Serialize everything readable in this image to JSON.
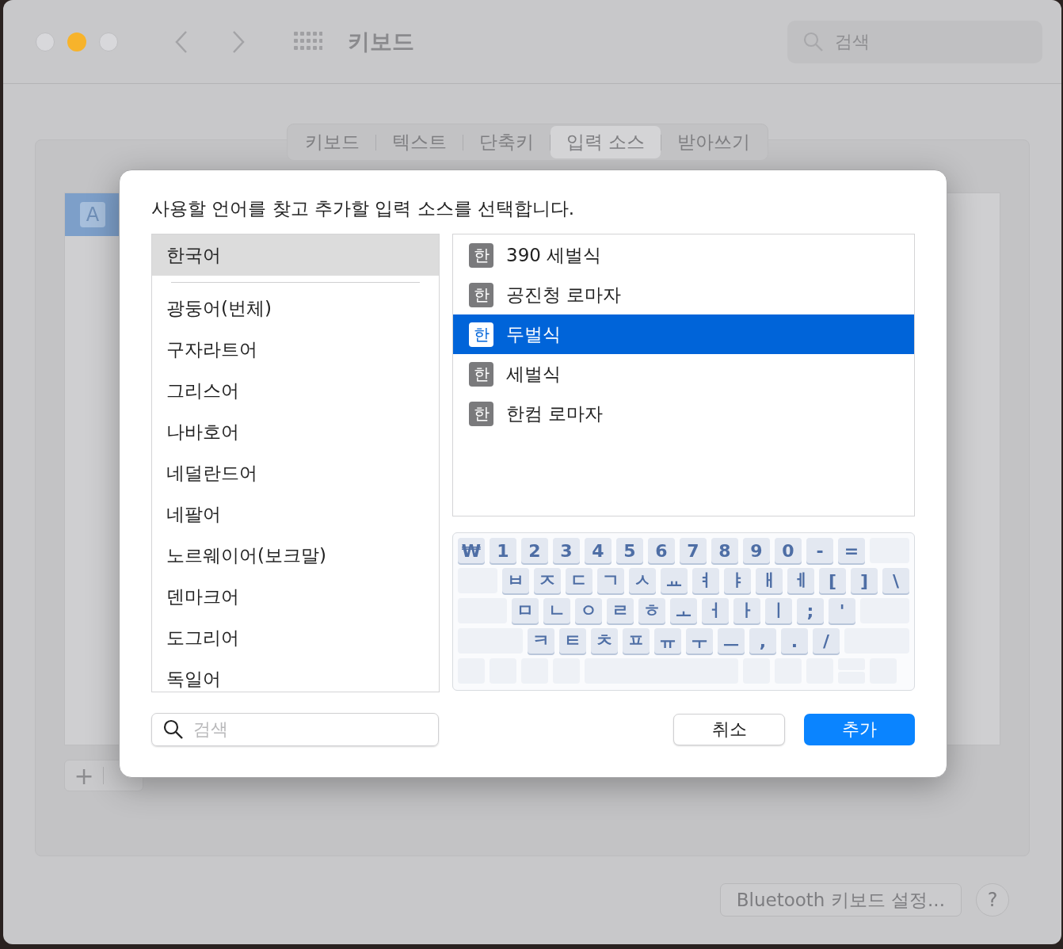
{
  "window": {
    "title": "키보드",
    "search": {
      "placeholder": "검색"
    },
    "traffic_lights": [
      {
        "kind": "close"
      },
      {
        "kind": "minimize"
      },
      {
        "kind": "zoom"
      }
    ]
  },
  "tabs": [
    {
      "label": "키보드",
      "selected": false
    },
    {
      "label": "텍스트",
      "selected": false
    },
    {
      "label": "단축키",
      "selected": false
    },
    {
      "label": "입력 소스",
      "selected": true
    },
    {
      "label": "받아쓰기",
      "selected": false
    }
  ],
  "source_list": {
    "items": [
      {
        "icon": "A",
        "selected": true
      }
    ],
    "add_button": "+"
  },
  "bluetooth_button": "Bluetooth 키보드 설정...",
  "help_button": "?",
  "dialog": {
    "prompt": "사용할 언어를 찾고 추가할 입력 소스를 선택합니다.",
    "languages": [
      {
        "label": "한국어",
        "selected": true,
        "kind": "pinned"
      },
      {
        "label": "광둥어(번체)",
        "selected": false
      },
      {
        "label": "구자라트어",
        "selected": false
      },
      {
        "label": "그리스어",
        "selected": false
      },
      {
        "label": "나바호어",
        "selected": false
      },
      {
        "label": "네덜란드어",
        "selected": false
      },
      {
        "label": "네팔어",
        "selected": false
      },
      {
        "label": "노르웨이어(보크말)",
        "selected": false
      },
      {
        "label": "덴마크어",
        "selected": false
      },
      {
        "label": "도그리어",
        "selected": false
      },
      {
        "label": "독일어",
        "selected": false
      }
    ],
    "sources": [
      {
        "badge": "한",
        "label": "390 세벌식",
        "selected": false
      },
      {
        "badge": "한",
        "label": "공진청 로마자",
        "selected": false
      },
      {
        "badge": "한",
        "label": "두벌식",
        "selected": true
      },
      {
        "badge": "한",
        "label": "세벌식",
        "selected": false
      },
      {
        "badge": "한",
        "label": "한컴 로마자",
        "selected": false
      }
    ],
    "keyboard": [
      [
        {
          "label": "₩"
        },
        {
          "label": "1"
        },
        {
          "label": "2"
        },
        {
          "label": "3"
        },
        {
          "label": "4"
        },
        {
          "label": "5"
        },
        {
          "label": "6"
        },
        {
          "label": "7"
        },
        {
          "label": "8"
        },
        {
          "label": "9"
        },
        {
          "label": "0"
        },
        {
          "label": "-"
        },
        {
          "label": "="
        },
        {
          "kind": "fill"
        }
      ],
      [
        {
          "kind": "fill"
        },
        {
          "label": "ㅂ"
        },
        {
          "label": "ㅈ"
        },
        {
          "label": "ㄷ"
        },
        {
          "label": "ㄱ"
        },
        {
          "label": "ㅅ"
        },
        {
          "label": "ㅛ"
        },
        {
          "label": "ㅕ"
        },
        {
          "label": "ㅑ"
        },
        {
          "label": "ㅐ"
        },
        {
          "label": "ㅔ"
        },
        {
          "label": "["
        },
        {
          "label": "]"
        },
        {
          "label": "\\"
        }
      ],
      [
        {
          "kind": "fill"
        },
        {
          "label": "ㅁ"
        },
        {
          "label": "ㄴ"
        },
        {
          "label": "ㅇ"
        },
        {
          "label": "ㄹ"
        },
        {
          "label": "ㅎ"
        },
        {
          "label": "ㅗ"
        },
        {
          "label": "ㅓ"
        },
        {
          "label": "ㅏ"
        },
        {
          "label": "ㅣ"
        },
        {
          "label": ";"
        },
        {
          "label": "'"
        },
        {
          "kind": "fill"
        }
      ],
      [
        {
          "kind": "fill"
        },
        {
          "label": "ㅋ"
        },
        {
          "label": "ㅌ"
        },
        {
          "label": "ㅊ"
        },
        {
          "label": "ㅍ"
        },
        {
          "label": "ㅠ"
        },
        {
          "label": "ㅜ"
        },
        {
          "label": "ㅡ"
        },
        {
          "label": ","
        },
        {
          "label": "."
        },
        {
          "label": "/"
        },
        {
          "kind": "fill"
        }
      ],
      [
        {
          "kind": "blank"
        },
        {
          "kind": "blank"
        },
        {
          "kind": "blank"
        },
        {
          "kind": "blank"
        },
        {
          "kind": "space"
        },
        {
          "kind": "blank"
        },
        {
          "kind": "blank"
        },
        {
          "kind": "blank"
        },
        {
          "kind": "arrows"
        },
        {
          "kind": "blank"
        }
      ]
    ],
    "search": {
      "placeholder": "검색"
    },
    "cancel_button": "취소",
    "add_button": "추가"
  }
}
